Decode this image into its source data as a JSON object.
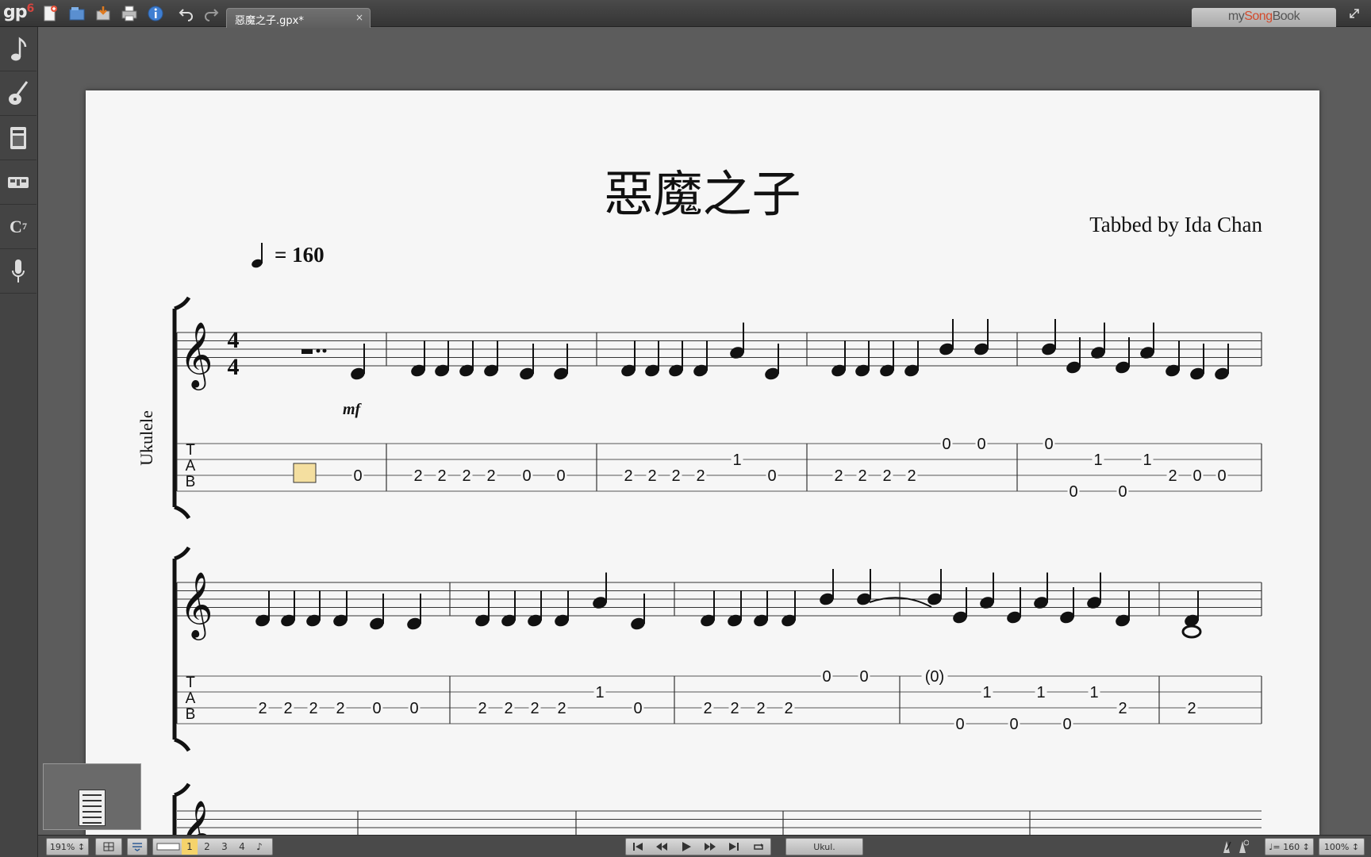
{
  "app": {
    "logo_text": "gp",
    "logo_version": "6"
  },
  "toolbar": {
    "icons": [
      "new-file-icon",
      "open-file-icon",
      "save-icon",
      "print-icon",
      "info-icon",
      "undo-icon",
      "redo-icon"
    ]
  },
  "tab": {
    "label": "惡魔之子.gpx*",
    "close": "×"
  },
  "mysongbook": {
    "prefix": "my",
    "brand": "Song",
    "suffix": "Book"
  },
  "sidebar": {
    "items": [
      "note-icon",
      "guitar-icon",
      "amp-icon",
      "mixer-icon",
      "chord-icon",
      "microphone-icon"
    ],
    "chord_label": "C",
    "chord_sup": "7"
  },
  "score": {
    "title": "惡魔之子",
    "credit": "Tabbed by Ida Chan",
    "tempo": "= 160",
    "instrument": "Ukulele",
    "dynamic": "mf",
    "time_signature": [
      "4",
      "4"
    ],
    "tab_letters": [
      "T",
      "A",
      "B"
    ],
    "system1_tab": [
      {
        "t": "0",
        "s": 2
      },
      {
        "t": "2",
        "s": 2
      },
      {
        "t": "2",
        "s": 2
      },
      {
        "t": "2",
        "s": 2
      },
      {
        "t": "2",
        "s": 2
      },
      {
        "t": "0",
        "s": 2
      },
      {
        "t": "0",
        "s": 2
      },
      {
        "t": "2",
        "s": 2
      },
      {
        "t": "2",
        "s": 2
      },
      {
        "t": "2",
        "s": 2
      },
      {
        "t": "2",
        "s": 2
      },
      {
        "t": "1",
        "s": 1
      },
      {
        "t": "0",
        "s": 2
      },
      {
        "t": "2",
        "s": 2
      },
      {
        "t": "2",
        "s": 2
      },
      {
        "t": "2",
        "s": 2
      },
      {
        "t": "2",
        "s": 2
      },
      {
        "t": "0",
        "s": 0
      },
      {
        "t": "0",
        "s": 0
      },
      {
        "t": "0",
        "s": 0
      },
      {
        "t": "0",
        "s": 3
      },
      {
        "t": "1",
        "s": 1
      },
      {
        "t": "0",
        "s": 3
      },
      {
        "t": "1",
        "s": 1
      },
      {
        "t": "2",
        "s": 2
      },
      {
        "t": "0",
        "s": 2
      },
      {
        "t": "0",
        "s": 2
      }
    ],
    "system2_tab": [
      {
        "t": "2",
        "s": 2
      },
      {
        "t": "2",
        "s": 2
      },
      {
        "t": "2",
        "s": 2
      },
      {
        "t": "2",
        "s": 2
      },
      {
        "t": "0",
        "s": 2
      },
      {
        "t": "0",
        "s": 2
      },
      {
        "t": "2",
        "s": 2
      },
      {
        "t": "2",
        "s": 2
      },
      {
        "t": "2",
        "s": 2
      },
      {
        "t": "2",
        "s": 2
      },
      {
        "t": "1",
        "s": 1
      },
      {
        "t": "0",
        "s": 2
      },
      {
        "t": "2",
        "s": 2
      },
      {
        "t": "2",
        "s": 2
      },
      {
        "t": "2",
        "s": 2
      },
      {
        "t": "2",
        "s": 2
      },
      {
        "t": "0",
        "s": 0
      },
      {
        "t": "0",
        "s": 0
      },
      {
        "t": "(0)",
        "s": 0
      },
      {
        "t": "0",
        "s": 3
      },
      {
        "t": "1",
        "s": 1
      },
      {
        "t": "0",
        "s": 3
      },
      {
        "t": "1",
        "s": 1
      },
      {
        "t": "0",
        "s": 3
      },
      {
        "t": "1",
        "s": 1
      },
      {
        "t": "2",
        "s": 2
      },
      {
        "t": "2",
        "s": 2
      }
    ]
  },
  "bottombar": {
    "zoom": "191%",
    "pages": [
      "1",
      "2",
      "3",
      "4"
    ],
    "track_label": "Ukul.",
    "tempo_readout": "♩= 160",
    "volume": "100%"
  }
}
